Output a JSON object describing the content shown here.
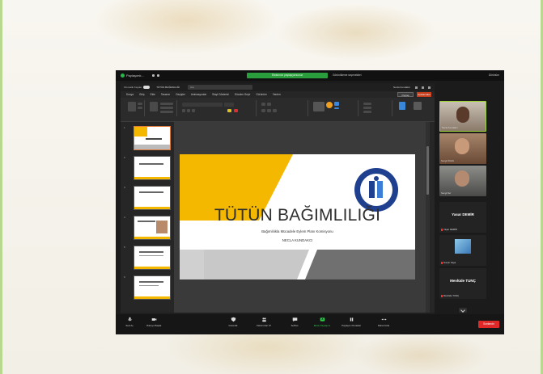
{
  "zoom": {
    "app_title": "Paylaşımlı...",
    "share_banner": "Ekranınızı paylaşıyorsunuz",
    "share_view": "Görüntüleme seçenekleri",
    "view_button": "Görünüm",
    "colors": {
      "accent_green": "#26b84a",
      "leave_red": "#e02828"
    }
  },
  "ppt": {
    "autosave_label": "Otomatik Kaydet",
    "doc_name": "TÜTÜN BAĞIMLILIĞI",
    "search_placeholder": "Ara",
    "user": "Necla Kundakcı",
    "menu": [
      "Dosya",
      "Giriş",
      "Ekle",
      "Tasarım",
      "Geçişler",
      "Animasyonlar",
      "Slayt Gösterisi",
      "Gözden Geçir",
      "Görünüm",
      "Yardım"
    ],
    "share_label": "Paylaş",
    "comment_label": "Açıklamalar",
    "thumb_numbers": [
      "1",
      "2",
      "3",
      "4",
      "5",
      "6"
    ],
    "status_text": "Slayt 1 / 25   Türkçe (Türkiye)   Erişilebilirlik: Araştırın",
    "zoom_level": "%85",
    "colors": {
      "accent_yellow": "#f5b800",
      "gray_band": "#707070"
    }
  },
  "slide": {
    "title": "TÜTÜN BAĞIMLILIĞI",
    "subtitle": "Bağımlılıkla Mücadele Eylem Planı Komisyonu",
    "author": "NECLA KUNDAKCI"
  },
  "participants": [
    {
      "name": "Necla Kundakcı",
      "kind": "video",
      "active": true
    },
    {
      "name": "Sevgi Öztürk",
      "kind": "video"
    },
    {
      "name": "Sevgi Nur",
      "kind": "video"
    },
    {
      "big_name": "Yasar DEMİR",
      "name": "Yaşar DEMİR",
      "kind": "name"
    },
    {
      "name": "Nurçin Kaya",
      "kind": "image"
    },
    {
      "big_name": "Mevlüde TUNÇ",
      "name": "Mevlüde TUNÇ",
      "kind": "name"
    }
  ],
  "toolbar": {
    "unmute": "Sesi Aç",
    "start_video": "Videoyu Başlat",
    "security": "Güvenlik",
    "participants": "Katılımcılar",
    "participants_count": "37",
    "chat": "Sohbet",
    "share_stop": "Ekran Paylaşımı",
    "pause_share": "Paylaşımı Duraklat",
    "more": "Daha Fazla",
    "leave": "Sonlandır"
  }
}
